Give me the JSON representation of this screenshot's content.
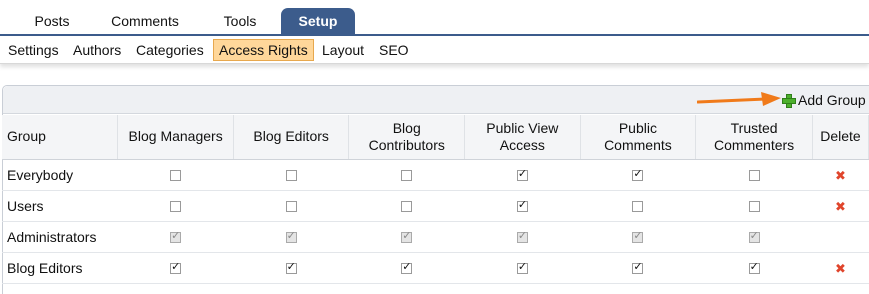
{
  "tabs": [
    {
      "label": "Posts",
      "active": false
    },
    {
      "label": "Comments",
      "active": false
    },
    {
      "label": "Tools",
      "active": false
    },
    {
      "label": "Setup",
      "active": true
    }
  ],
  "subnav": [
    {
      "label": "Settings",
      "active": false
    },
    {
      "label": "Authors",
      "active": false
    },
    {
      "label": "Categories",
      "active": false
    },
    {
      "label": "Access Rights",
      "active": true
    },
    {
      "label": "Layout",
      "active": false
    },
    {
      "label": "SEO",
      "active": false
    }
  ],
  "add_group_label": "Add Group",
  "table": {
    "headers": [
      "Group",
      "Blog Managers",
      "Blog Editors",
      "Blog Contributors",
      "Public View Access",
      "Public Comments",
      "Trusted Commenters",
      "Delete"
    ],
    "rows": [
      {
        "name": "Everybody",
        "checks": [
          false,
          false,
          false,
          true,
          true,
          false
        ],
        "disabled": false,
        "deletable": true
      },
      {
        "name": "Users",
        "checks": [
          false,
          false,
          false,
          true,
          false,
          false
        ],
        "disabled": false,
        "deletable": true
      },
      {
        "name": "Administrators",
        "checks": [
          true,
          true,
          true,
          true,
          true,
          true
        ],
        "disabled": true,
        "deletable": false
      },
      {
        "name": "Blog Editors",
        "checks": [
          true,
          true,
          true,
          true,
          true,
          true
        ],
        "disabled": false,
        "deletable": true
      }
    ]
  },
  "colors": {
    "tab_active_bg": "#3c5c8c",
    "subnav_active_bg": "#ffd79a",
    "arrow": "#f07a1a",
    "delete": "#e0452c",
    "add": "#4caf2c"
  }
}
